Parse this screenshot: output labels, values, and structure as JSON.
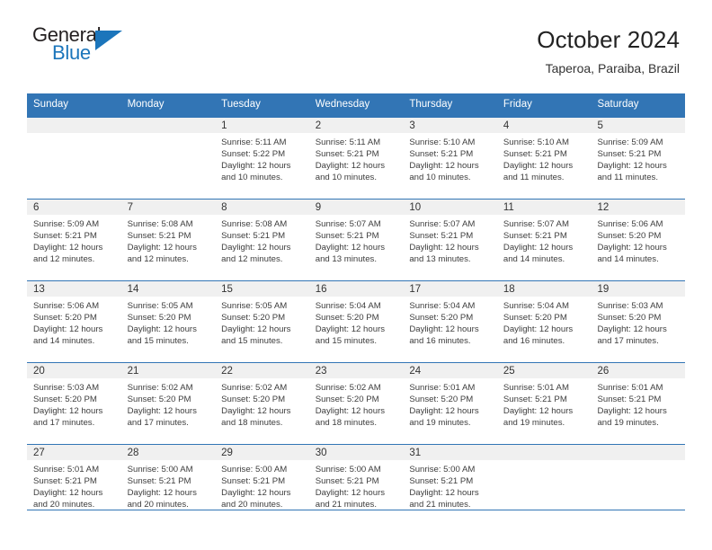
{
  "brand": {
    "name_top": "General",
    "name_bottom": "Blue",
    "triangle_icon": "blue-triangle-logo-mark",
    "color_dark": "#231f20",
    "color_blue": "#1b75bb"
  },
  "header": {
    "title": "October 2024",
    "subtitle": "Taperoa, Paraiba, Brazil"
  },
  "theme": {
    "header_blue": "#3275b5",
    "day_strip_gray": "#f0f0f0",
    "text_dark": "#333333"
  },
  "calendar": {
    "weekdays": [
      "Sunday",
      "Monday",
      "Tuesday",
      "Wednesday",
      "Thursday",
      "Friday",
      "Saturday"
    ],
    "labels": {
      "sunrise": "Sunrise:",
      "sunset": "Sunset:",
      "daylight": "Daylight:"
    },
    "weeks": [
      [
        {
          "day": "",
          "line1": "",
          "line2": "",
          "line3": "",
          "line4": ""
        },
        {
          "day": "",
          "line1": "",
          "line2": "",
          "line3": "",
          "line4": ""
        },
        {
          "day": "1",
          "line1": "Sunrise: 5:11 AM",
          "line2": "Sunset: 5:22 PM",
          "line3": "Daylight: 12 hours",
          "line4": "and 10 minutes."
        },
        {
          "day": "2",
          "line1": "Sunrise: 5:11 AM",
          "line2": "Sunset: 5:21 PM",
          "line3": "Daylight: 12 hours",
          "line4": "and 10 minutes."
        },
        {
          "day": "3",
          "line1": "Sunrise: 5:10 AM",
          "line2": "Sunset: 5:21 PM",
          "line3": "Daylight: 12 hours",
          "line4": "and 10 minutes."
        },
        {
          "day": "4",
          "line1": "Sunrise: 5:10 AM",
          "line2": "Sunset: 5:21 PM",
          "line3": "Daylight: 12 hours",
          "line4": "and 11 minutes."
        },
        {
          "day": "5",
          "line1": "Sunrise: 5:09 AM",
          "line2": "Sunset: 5:21 PM",
          "line3": "Daylight: 12 hours",
          "line4": "and 11 minutes."
        }
      ],
      [
        {
          "day": "6",
          "line1": "Sunrise: 5:09 AM",
          "line2": "Sunset: 5:21 PM",
          "line3": "Daylight: 12 hours",
          "line4": "and 12 minutes."
        },
        {
          "day": "7",
          "line1": "Sunrise: 5:08 AM",
          "line2": "Sunset: 5:21 PM",
          "line3": "Daylight: 12 hours",
          "line4": "and 12 minutes."
        },
        {
          "day": "8",
          "line1": "Sunrise: 5:08 AM",
          "line2": "Sunset: 5:21 PM",
          "line3": "Daylight: 12 hours",
          "line4": "and 12 minutes."
        },
        {
          "day": "9",
          "line1": "Sunrise: 5:07 AM",
          "line2": "Sunset: 5:21 PM",
          "line3": "Daylight: 12 hours",
          "line4": "and 13 minutes."
        },
        {
          "day": "10",
          "line1": "Sunrise: 5:07 AM",
          "line2": "Sunset: 5:21 PM",
          "line3": "Daylight: 12 hours",
          "line4": "and 13 minutes."
        },
        {
          "day": "11",
          "line1": "Sunrise: 5:07 AM",
          "line2": "Sunset: 5:21 PM",
          "line3": "Daylight: 12 hours",
          "line4": "and 14 minutes."
        },
        {
          "day": "12",
          "line1": "Sunrise: 5:06 AM",
          "line2": "Sunset: 5:20 PM",
          "line3": "Daylight: 12 hours",
          "line4": "and 14 minutes."
        }
      ],
      [
        {
          "day": "13",
          "line1": "Sunrise: 5:06 AM",
          "line2": "Sunset: 5:20 PM",
          "line3": "Daylight: 12 hours",
          "line4": "and 14 minutes."
        },
        {
          "day": "14",
          "line1": "Sunrise: 5:05 AM",
          "line2": "Sunset: 5:20 PM",
          "line3": "Daylight: 12 hours",
          "line4": "and 15 minutes."
        },
        {
          "day": "15",
          "line1": "Sunrise: 5:05 AM",
          "line2": "Sunset: 5:20 PM",
          "line3": "Daylight: 12 hours",
          "line4": "and 15 minutes."
        },
        {
          "day": "16",
          "line1": "Sunrise: 5:04 AM",
          "line2": "Sunset: 5:20 PM",
          "line3": "Daylight: 12 hours",
          "line4": "and 15 minutes."
        },
        {
          "day": "17",
          "line1": "Sunrise: 5:04 AM",
          "line2": "Sunset: 5:20 PM",
          "line3": "Daylight: 12 hours",
          "line4": "and 16 minutes."
        },
        {
          "day": "18",
          "line1": "Sunrise: 5:04 AM",
          "line2": "Sunset: 5:20 PM",
          "line3": "Daylight: 12 hours",
          "line4": "and 16 minutes."
        },
        {
          "day": "19",
          "line1": "Sunrise: 5:03 AM",
          "line2": "Sunset: 5:20 PM",
          "line3": "Daylight: 12 hours",
          "line4": "and 17 minutes."
        }
      ],
      [
        {
          "day": "20",
          "line1": "Sunrise: 5:03 AM",
          "line2": "Sunset: 5:20 PM",
          "line3": "Daylight: 12 hours",
          "line4": "and 17 minutes."
        },
        {
          "day": "21",
          "line1": "Sunrise: 5:02 AM",
          "line2": "Sunset: 5:20 PM",
          "line3": "Daylight: 12 hours",
          "line4": "and 17 minutes."
        },
        {
          "day": "22",
          "line1": "Sunrise: 5:02 AM",
          "line2": "Sunset: 5:20 PM",
          "line3": "Daylight: 12 hours",
          "line4": "and 18 minutes."
        },
        {
          "day": "23",
          "line1": "Sunrise: 5:02 AM",
          "line2": "Sunset: 5:20 PM",
          "line3": "Daylight: 12 hours",
          "line4": "and 18 minutes."
        },
        {
          "day": "24",
          "line1": "Sunrise: 5:01 AM",
          "line2": "Sunset: 5:20 PM",
          "line3": "Daylight: 12 hours",
          "line4": "and 19 minutes."
        },
        {
          "day": "25",
          "line1": "Sunrise: 5:01 AM",
          "line2": "Sunset: 5:21 PM",
          "line3": "Daylight: 12 hours",
          "line4": "and 19 minutes."
        },
        {
          "day": "26",
          "line1": "Sunrise: 5:01 AM",
          "line2": "Sunset: 5:21 PM",
          "line3": "Daylight: 12 hours",
          "line4": "and 19 minutes."
        }
      ],
      [
        {
          "day": "27",
          "line1": "Sunrise: 5:01 AM",
          "line2": "Sunset: 5:21 PM",
          "line3": "Daylight: 12 hours",
          "line4": "and 20 minutes."
        },
        {
          "day": "28",
          "line1": "Sunrise: 5:00 AM",
          "line2": "Sunset: 5:21 PM",
          "line3": "Daylight: 12 hours",
          "line4": "and 20 minutes."
        },
        {
          "day": "29",
          "line1": "Sunrise: 5:00 AM",
          "line2": "Sunset: 5:21 PM",
          "line3": "Daylight: 12 hours",
          "line4": "and 20 minutes."
        },
        {
          "day": "30",
          "line1": "Sunrise: 5:00 AM",
          "line2": "Sunset: 5:21 PM",
          "line3": "Daylight: 12 hours",
          "line4": "and 21 minutes."
        },
        {
          "day": "31",
          "line1": "Sunrise: 5:00 AM",
          "line2": "Sunset: 5:21 PM",
          "line3": "Daylight: 12 hours",
          "line4": "and 21 minutes."
        },
        {
          "day": "",
          "line1": "",
          "line2": "",
          "line3": "",
          "line4": ""
        },
        {
          "day": "",
          "line1": "",
          "line2": "",
          "line3": "",
          "line4": ""
        }
      ]
    ]
  }
}
